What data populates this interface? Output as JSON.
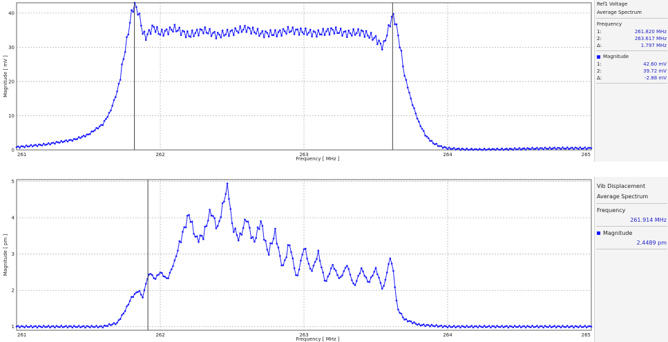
{
  "chart_data": [
    {
      "type": "line",
      "xlabel": "Frequency [ MHz ]",
      "ylabel": "Magnitude [ mV ]",
      "xlim": [
        261,
        265
      ],
      "ylim": [
        0,
        43
      ],
      "x_ticks": [
        "261",
        "262",
        "263",
        "264",
        "265"
      ],
      "y_ticks": [
        "0",
        "10",
        "20",
        "30",
        "40"
      ],
      "grid": true,
      "cursor_lines": [
        261.82,
        263.617
      ],
      "series_color": "#1a1aff",
      "series": [
        {
          "x": [
            261.0,
            261.2,
            261.4,
            261.5,
            261.6,
            261.65,
            261.7,
            261.72,
            261.75,
            261.78,
            261.8,
            261.82,
            261.85,
            261.88,
            261.9,
            261.95,
            262.0,
            262.1,
            262.2,
            262.3,
            262.4,
            262.5,
            262.6,
            262.7,
            262.8,
            262.9,
            263.0,
            263.1,
            263.2,
            263.3,
            263.4,
            263.5,
            263.55,
            263.6,
            263.617,
            263.64,
            263.67,
            263.7,
            263.75,
            263.8,
            263.85,
            263.9,
            263.95,
            264.0,
            264.1,
            264.2,
            264.4,
            264.6,
            264.8,
            265.0
          ],
          "y": [
            0.8,
            1.6,
            3.0,
            4.5,
            7.5,
            11.0,
            17.0,
            21.0,
            28.0,
            35.0,
            40.0,
            42.6,
            40.0,
            34.0,
            33.0,
            36.0,
            34.0,
            35.5,
            33.5,
            35.0,
            33.5,
            34.5,
            35.5,
            34.0,
            34.0,
            35.0,
            34.5,
            34.0,
            35.0,
            34.0,
            34.5,
            32.5,
            30.0,
            37.0,
            39.7,
            37.0,
            30.0,
            22.0,
            14.0,
            8.0,
            4.0,
            2.0,
            1.0,
            0.5,
            0.2,
            0.1,
            0.2,
            0.4,
            0.5,
            0.5
          ]
        }
      ]
    },
    {
      "type": "line",
      "xlabel": "Frequency [ MHz ]",
      "ylabel": "Magnitude [ pm ]",
      "xlim": [
        261,
        265
      ],
      "ylim": [
        0.9,
        5.05
      ],
      "x_ticks": [
        "261",
        "262",
        "263",
        "264",
        "265"
      ],
      "y_ticks": [
        "1",
        "2",
        "3",
        "4",
        "5"
      ],
      "grid": true,
      "cursor_lines": [
        261.914
      ],
      "series_color": "#1a1aff",
      "series": [
        {
          "x": [
            261.0,
            261.3,
            261.6,
            261.7,
            261.75,
            261.8,
            261.85,
            261.88,
            261.9,
            261.93,
            261.96,
            262.0,
            262.05,
            262.1,
            262.15,
            262.2,
            262.25,
            262.3,
            262.35,
            262.4,
            262.45,
            262.47,
            262.5,
            262.55,
            262.6,
            262.65,
            262.7,
            262.75,
            262.8,
            262.85,
            262.9,
            262.95,
            263.0,
            263.05,
            263.1,
            263.15,
            263.2,
            263.25,
            263.3,
            263.35,
            263.4,
            263.45,
            263.5,
            263.55,
            263.6,
            263.62,
            263.65,
            263.7,
            263.8,
            264.0,
            264.5,
            265.0
          ],
          "y": [
            1.0,
            1.0,
            1.0,
            1.1,
            1.4,
            1.8,
            2.0,
            1.8,
            2.2,
            2.5,
            2.3,
            2.5,
            2.3,
            2.8,
            3.5,
            4.1,
            3.4,
            3.5,
            4.2,
            3.7,
            4.6,
            4.9,
            3.8,
            3.4,
            4.0,
            3.3,
            3.9,
            3.0,
            3.6,
            2.6,
            3.3,
            2.3,
            3.2,
            2.5,
            3.0,
            2.2,
            2.7,
            2.3,
            2.7,
            2.1,
            2.6,
            2.2,
            2.6,
            2.0,
            2.9,
            2.6,
            1.5,
            1.2,
            1.05,
            1.0,
            1.0,
            1.0
          ]
        }
      ]
    }
  ],
  "panel1": {
    "title": "Ref1 Voltage",
    "subtitle": "Average Spectrum",
    "frequency_label": "Frequency",
    "freq_rows": [
      {
        "label": "1:",
        "value": "261.820 MHz"
      },
      {
        "label": "2:",
        "value": "263.617 MHz"
      },
      {
        "label": "Δ:",
        "value": "1.797 MHz"
      }
    ],
    "magnitude_label": "Magnitude",
    "mag_rows": [
      {
        "label": "1:",
        "value": "42.60 mV"
      },
      {
        "label": "2:",
        "value": "39.72 mV"
      },
      {
        "label": "Δ:",
        "value": "-2.88 mV"
      }
    ]
  },
  "panel2": {
    "title": "Vib Displacement",
    "subtitle": "Average Spectrum",
    "frequency_label": "Frequency",
    "frequency_value": "261.914 MHz",
    "magnitude_label": "Magnitude",
    "magnitude_value": "2.4489 pm"
  }
}
